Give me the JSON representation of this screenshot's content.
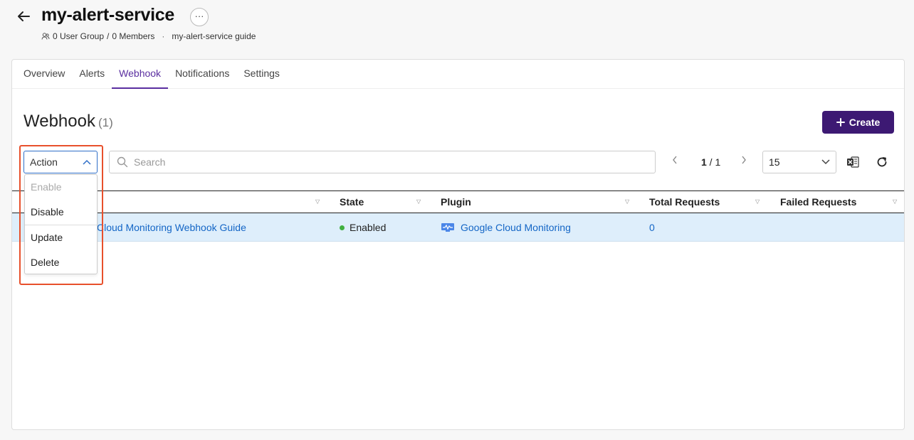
{
  "header": {
    "title": "my-alert-service",
    "more_label": "···",
    "user_group_text": "0 User Group",
    "members_text": "0 Members",
    "separator": "/",
    "dot": "·",
    "guide_text": "my-alert-service guide"
  },
  "tabs": [
    {
      "label": "Overview",
      "active": false
    },
    {
      "label": "Alerts",
      "active": false
    },
    {
      "label": "Webhook",
      "active": true
    },
    {
      "label": "Notifications",
      "active": false
    },
    {
      "label": "Settings",
      "active": false
    }
  ],
  "section": {
    "title": "Webhook",
    "count": "(1)"
  },
  "toolbar": {
    "create_label": "Create",
    "action_label": "Action",
    "search_placeholder": "Search",
    "page_current": "1",
    "page_separator": " / ",
    "page_total": "1",
    "page_size": "15"
  },
  "action_menu": {
    "items": [
      {
        "label": "Enable",
        "disabled": true
      },
      {
        "label": "Disable",
        "disabled": false
      },
      {
        "label": "Update",
        "disabled": false
      },
      {
        "label": "Delete",
        "disabled": false
      }
    ]
  },
  "table": {
    "columns": [
      "State",
      "Plugin",
      "Total Requests",
      "Failed Requests"
    ],
    "rows": [
      {
        "name": "Cloud Monitoring Webhook Guide",
        "state": "Enabled",
        "plugin": "Google Cloud Monitoring",
        "total_requests": "0",
        "failed_requests": ""
      }
    ]
  },
  "colors": {
    "accent": "#5a2ea0",
    "create_bg": "#3d1973",
    "link": "#1466c6",
    "row_selected": "#deeefb",
    "highlight": "#e8502c",
    "state_enabled": "#40b040"
  },
  "icons": {
    "back": "arrow-left-icon",
    "user": "user-group-icon",
    "search": "search-icon",
    "chevron": "chevron-down-icon",
    "excel": "excel-icon",
    "refresh": "refresh-icon",
    "plugin": "google-cloud-monitoring-icon"
  }
}
